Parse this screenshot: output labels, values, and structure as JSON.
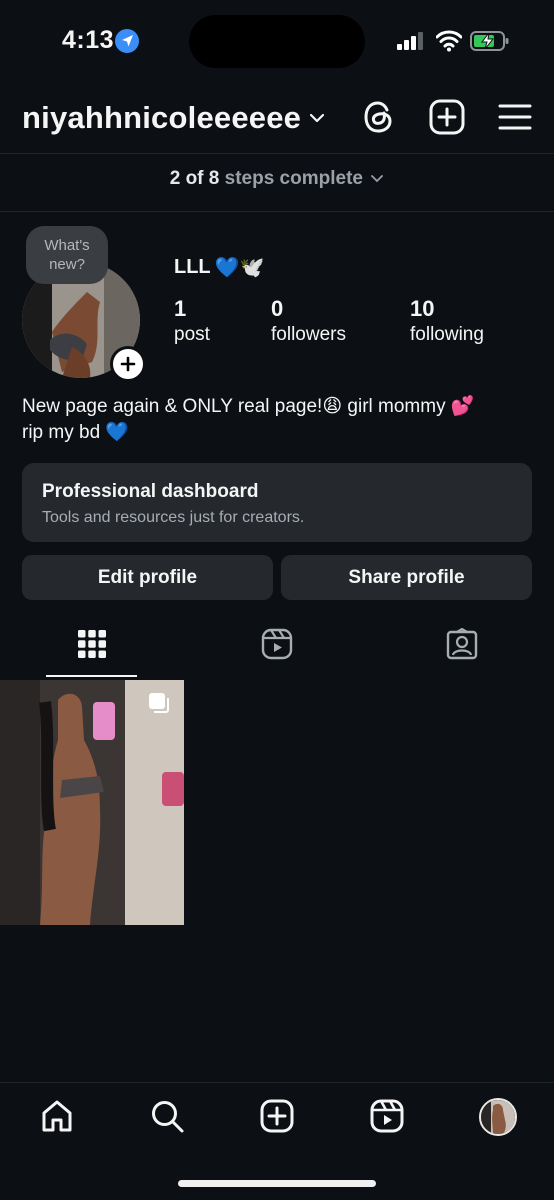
{
  "status_bar": {
    "time": "4:13"
  },
  "header": {
    "username": "niyahhnicoleeeeee"
  },
  "onboarding": {
    "steps_done": "2 of 8",
    "steps_rest": "steps complete"
  },
  "profile": {
    "note": "What's new?",
    "display_name": "LLL",
    "name_emojis": "💙🕊️",
    "stats": [
      {
        "value": "1",
        "label": "post"
      },
      {
        "value": "0",
        "label": "followers"
      },
      {
        "value": "10",
        "label": "following"
      }
    ],
    "bio_line1": "New page again & ONLY real page!😩 girl mommy 💕",
    "bio_line2": "rip my bd 💙"
  },
  "dashboard": {
    "title": "Professional dashboard",
    "subtitle": "Tools and resources just for creators."
  },
  "buttons": {
    "edit": "Edit profile",
    "share": "Share profile"
  },
  "tabs": {
    "active": "grid"
  },
  "colors": {
    "background": "#0c1014",
    "card": "#25292e",
    "accent_location": "#3b8df7",
    "battery": "#34c759"
  }
}
